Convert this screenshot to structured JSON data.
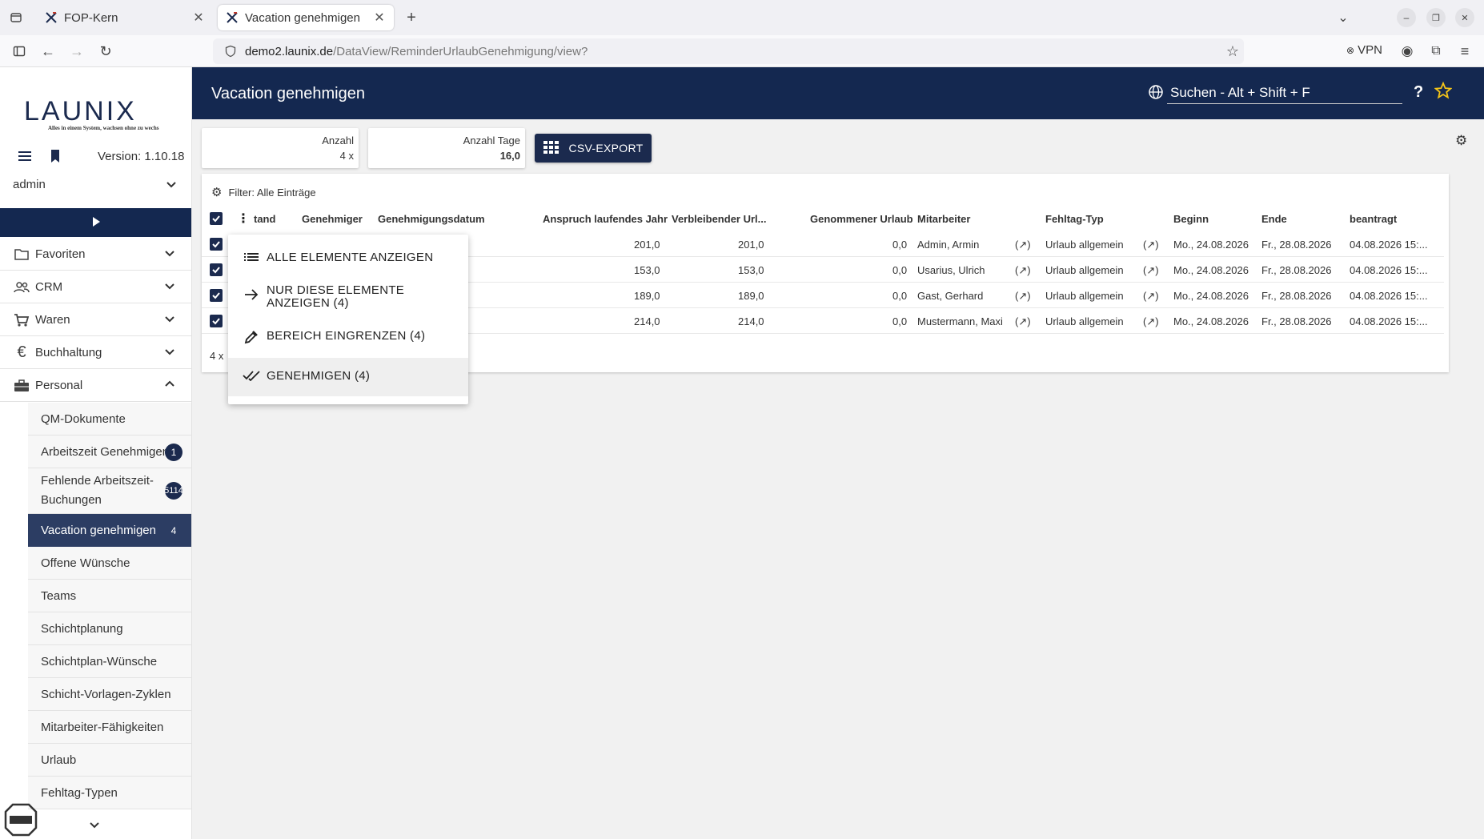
{
  "browser": {
    "tabs": [
      {
        "title": "FOP-Kern"
      },
      {
        "title": "Vacation genehmigen"
      }
    ],
    "url_host": "demo2.launix.de",
    "url_path": "/DataView/ReminderUrlaubGenehmigung/view?",
    "vpn_label": "VPN"
  },
  "sidebar": {
    "logo_word": "LAUNIX",
    "logo_slogan": "Alles in einem System, wachsen ohne zu wechs",
    "version": "Version: 1.10.18",
    "user": "admin",
    "menu": [
      {
        "label": "Favoriten",
        "icon": "folder-icon"
      },
      {
        "label": "CRM",
        "icon": "people-icon"
      },
      {
        "label": "Waren",
        "icon": "cart-icon"
      },
      {
        "label": "Buchhaltung",
        "icon": "euro-icon"
      },
      {
        "label": "Personal",
        "icon": "briefcase-icon"
      }
    ],
    "sub_items": [
      {
        "label": "QM-Dokumente",
        "badge": ""
      },
      {
        "label": "Arbeitszeit Genehmigen",
        "badge": "1"
      },
      {
        "label": "Fehlende Arbeitszeit-Buchungen",
        "badge": "5114"
      },
      {
        "label": "Vacation genehmigen",
        "badge": "4"
      },
      {
        "label": "Offene Wünsche",
        "badge": ""
      },
      {
        "label": "Teams",
        "badge": ""
      },
      {
        "label": "Schichtplanung",
        "badge": ""
      },
      {
        "label": "Schichtplan-Wünsche",
        "badge": ""
      },
      {
        "label": "Schicht-Vorlagen-Zyklen",
        "badge": ""
      },
      {
        "label": "Mitarbeiter-Fähigkeiten",
        "badge": ""
      },
      {
        "label": "Urlaub",
        "badge": ""
      },
      {
        "label": "Fehltag-Typen",
        "badge": ""
      }
    ]
  },
  "header": {
    "title": "Vacation genehmigen",
    "search_label": "Suchen - Alt + Shift + F",
    "help": "?"
  },
  "cards": {
    "anzahl_label": "Anzahl",
    "anzahl_value": "4 x",
    "tage_label": "Anzahl Tage",
    "tage_value": "16,0",
    "csv_label": "CSV-EXPORT"
  },
  "table": {
    "filter": "Filter: Alle Einträge",
    "columns": [
      "tand",
      "Genehmiger",
      "Genehmigungsdatum",
      "Anspruch laufendes Jahr",
      "Verbleibender Url...",
      "Genommener Urlaub",
      "Mitarbeiter",
      "Fehltag-Typ",
      "Beginn",
      "Ende",
      "beantragt"
    ],
    "rows": [
      {
        "anspruch": "201,0",
        "verbleibend": "201,0",
        "genommen": "0,0",
        "mitarbeiter": "Admin, Armin",
        "typ": "Urlaub allgemein",
        "beginn": "Mo., 24.08.2026",
        "ende": "Fr., 28.08.2026",
        "beantragt": "04.08.2026 15:..."
      },
      {
        "anspruch": "153,0",
        "verbleibend": "153,0",
        "genommen": "0,0",
        "mitarbeiter": "Usarius, Ulrich",
        "typ": "Urlaub allgemein",
        "beginn": "Mo., 24.08.2026",
        "ende": "Fr., 28.08.2026",
        "beantragt": "04.08.2026 15:..."
      },
      {
        "anspruch": "189,0",
        "verbleibend": "189,0",
        "genommen": "0,0",
        "mitarbeiter": "Gast, Gerhard",
        "typ": "Urlaub allgemein",
        "beginn": "Mo., 24.08.2026",
        "ende": "Fr., 28.08.2026",
        "beantragt": "04.08.2026 15:..."
      },
      {
        "anspruch": "214,0",
        "verbleibend": "214,0",
        "genommen": "0,0",
        "mitarbeiter": "Mustermann, Maxi",
        "typ": "Urlaub allgemein",
        "beginn": "Mo., 24.08.2026",
        "ende": "Fr., 28.08.2026",
        "beantragt": "04.08.2026 15:..."
      }
    ],
    "footer_count": "4 x",
    "link_glyph": "(↗)"
  },
  "dropdown": {
    "items": [
      {
        "label": "ALLE ELEMENTE ANZEIGEN"
      },
      {
        "label": "NUR DIESE ELEMENTE ANZEIGEN (4)"
      },
      {
        "label": "BEREICH EINGRENZEN (4)"
      },
      {
        "label": "GENEHMIGEN (4)"
      }
    ]
  },
  "colors": {
    "primary": "#142850",
    "active_item": "#2c3d63",
    "accent_star": "#f5c518"
  }
}
